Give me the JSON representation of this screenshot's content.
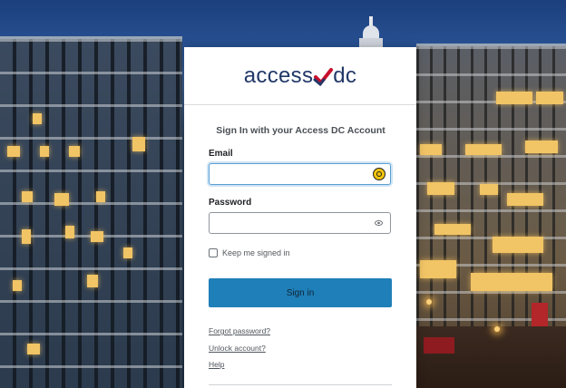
{
  "logo": {
    "text_access": "access",
    "text_dc": "dc"
  },
  "form": {
    "title": "Sign In with your Access DC Account",
    "email_label": "Email",
    "email_value": "",
    "password_label": "Password",
    "password_value": "",
    "keep_signed_in_label": "Keep me signed in",
    "keep_signed_in_checked": false,
    "signin_button": "Sign in"
  },
  "links": {
    "forgot_password": "Forgot password?",
    "unlock_account": "Unlock account?",
    "help": "Help"
  },
  "colors": {
    "brand_navy": "#223868",
    "brand_red": "#c8102e",
    "button": "#1f7fb8",
    "focus": "#5a9fd4"
  },
  "icons": [
    "keeper-password-manager-icon",
    "show-password-eye-icon",
    "checkmark-logo-icon"
  ]
}
